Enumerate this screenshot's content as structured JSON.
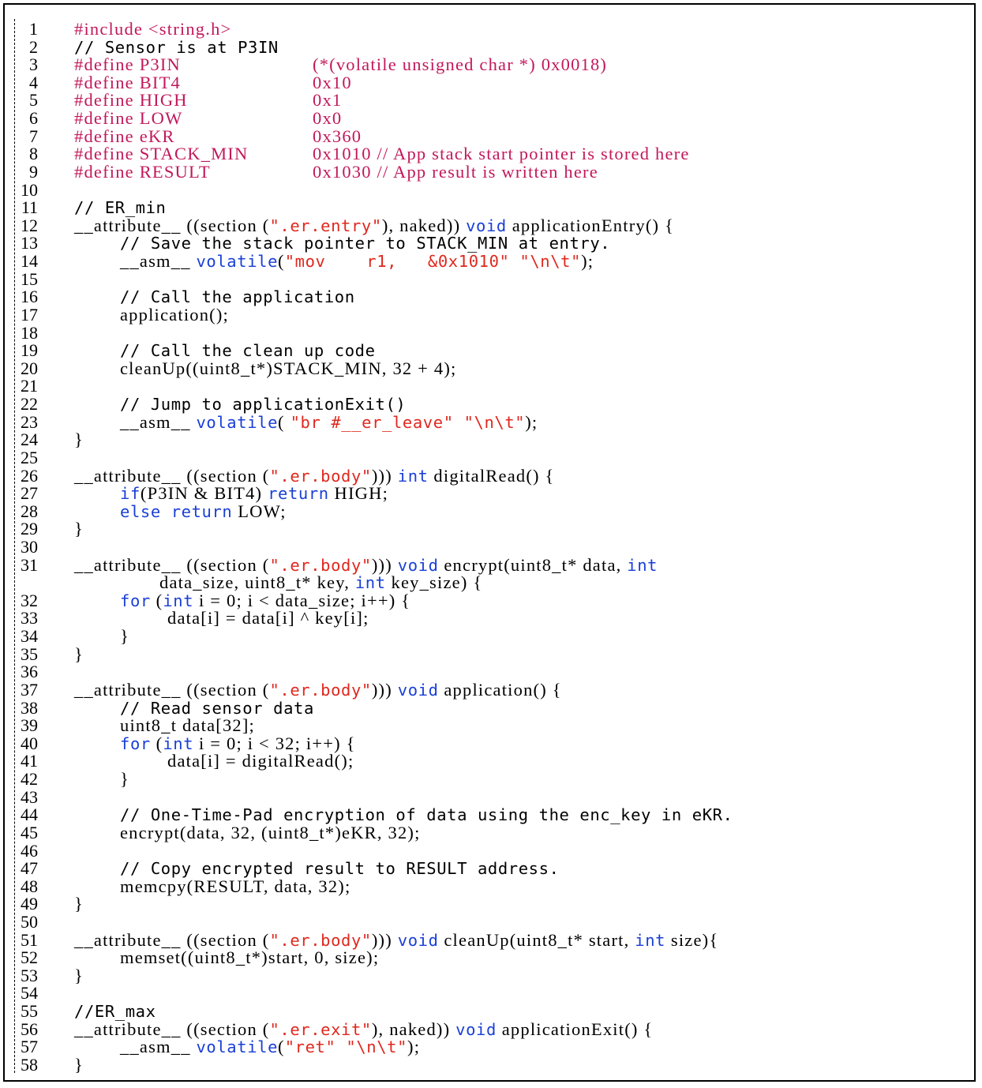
{
  "colors": {
    "preprocessor": "#c2185b",
    "keyword": "#1a3fd6",
    "string": "#e0281e",
    "text": "#000000"
  },
  "lines": [
    {
      "n": "1",
      "indent": 0,
      "tokens": [
        {
          "t": "pp",
          "v": "#include <string.h>"
        }
      ]
    },
    {
      "n": "2",
      "indent": 0,
      "tokens": [
        {
          "t": "cm",
          "v": "// Sensor is at P3IN"
        }
      ]
    },
    {
      "n": "3",
      "indent": 0,
      "tokens": [
        {
          "t": "pp",
          "v": "#define P3IN"
        },
        {
          "t": "pp",
          "v": "(*(volatile unsigned char *) 0x0018)",
          "col": 2
        }
      ]
    },
    {
      "n": "4",
      "indent": 0,
      "tokens": [
        {
          "t": "pp",
          "v": "#define BIT4"
        },
        {
          "t": "pp",
          "v": "0x10",
          "col": 2
        }
      ]
    },
    {
      "n": "5",
      "indent": 0,
      "tokens": [
        {
          "t": "pp",
          "v": "#define HIGH"
        },
        {
          "t": "pp",
          "v": "0x1",
          "col": 2
        }
      ]
    },
    {
      "n": "6",
      "indent": 0,
      "tokens": [
        {
          "t": "pp",
          "v": "#define LOW"
        },
        {
          "t": "pp",
          "v": "0x0",
          "col": 2
        }
      ]
    },
    {
      "n": "7",
      "indent": 0,
      "tokens": [
        {
          "t": "pp",
          "v": "#define eKR"
        },
        {
          "t": "pp",
          "v": "0x360",
          "col": 2
        }
      ]
    },
    {
      "n": "8",
      "indent": 0,
      "tokens": [
        {
          "t": "pp",
          "v": "#define STACK_MIN"
        },
        {
          "t": "pp",
          "v": "0x1010 // App stack start pointer is stored here",
          "col": 2
        }
      ]
    },
    {
      "n": "9",
      "indent": 0,
      "tokens": [
        {
          "t": "pp",
          "v": "#define RESULT"
        },
        {
          "t": "pp",
          "v": "0x1030 // App result is written here",
          "col": 2
        }
      ]
    },
    {
      "n": "10",
      "indent": 0,
      "tokens": []
    },
    {
      "n": "11",
      "indent": 0,
      "tokens": [
        {
          "t": "cm",
          "v": "// ER_min"
        }
      ]
    },
    {
      "n": "12",
      "indent": 0,
      "tokens": [
        {
          "t": "nm",
          "v": "__attribute__ ((section ("
        },
        {
          "t": "st",
          "v": "\".er.entry\""
        },
        {
          "t": "nm",
          "v": "), naked)) "
        },
        {
          "t": "kw",
          "v": "void"
        },
        {
          "t": "nm",
          "v": " applicationEntry() {"
        }
      ]
    },
    {
      "n": "13",
      "indent": 1,
      "tokens": [
        {
          "t": "cm",
          "v": "// Save the stack pointer to STACK_MIN at entry."
        }
      ]
    },
    {
      "n": "14",
      "indent": 1,
      "tokens": [
        {
          "t": "nm",
          "v": "__asm__ "
        },
        {
          "t": "kw",
          "v": "volatile"
        },
        {
          "t": "nm",
          "v": "("
        },
        {
          "t": "st",
          "v": "\"mov    r1,   &0x1010\" \"\\n\\t\""
        },
        {
          "t": "nm",
          "v": ");"
        }
      ]
    },
    {
      "n": "15",
      "indent": 0,
      "tokens": []
    },
    {
      "n": "16",
      "indent": 1,
      "tokens": [
        {
          "t": "cm",
          "v": "// Call the application"
        }
      ]
    },
    {
      "n": "17",
      "indent": 1,
      "tokens": [
        {
          "t": "nm",
          "v": "application();"
        }
      ]
    },
    {
      "n": "18",
      "indent": 0,
      "tokens": []
    },
    {
      "n": "19",
      "indent": 1,
      "tokens": [
        {
          "t": "cm",
          "v": "// Call the clean up code"
        }
      ]
    },
    {
      "n": "20",
      "indent": 1,
      "tokens": [
        {
          "t": "nm",
          "v": "cleanUp((uint8_t*)STACK_MIN, 32 + 4);"
        }
      ]
    },
    {
      "n": "21",
      "indent": 0,
      "tokens": []
    },
    {
      "n": "22",
      "indent": 1,
      "tokens": [
        {
          "t": "cm",
          "v": "// Jump to applicationExit()"
        }
      ]
    },
    {
      "n": "23",
      "indent": 1,
      "tokens": [
        {
          "t": "nm",
          "v": "__asm__ "
        },
        {
          "t": "kw",
          "v": "volatile"
        },
        {
          "t": "nm",
          "v": "( "
        },
        {
          "t": "st",
          "v": "\"br #__er_leave\" \"\\n\\t\""
        },
        {
          "t": "nm",
          "v": ");"
        }
      ]
    },
    {
      "n": "24",
      "indent": 0,
      "tokens": [
        {
          "t": "nm",
          "v": "}"
        }
      ]
    },
    {
      "n": "25",
      "indent": 0,
      "tokens": []
    },
    {
      "n": "26",
      "indent": 0,
      "tokens": [
        {
          "t": "nm",
          "v": "__attribute__ ((section ("
        },
        {
          "t": "st",
          "v": "\".er.body\""
        },
        {
          "t": "nm",
          "v": "))) "
        },
        {
          "t": "kw",
          "v": "int"
        },
        {
          "t": "nm",
          "v": " digitalRead() {"
        }
      ]
    },
    {
      "n": "27",
      "indent": 1,
      "tokens": [
        {
          "t": "kw",
          "v": "if"
        },
        {
          "t": "nm",
          "v": "(P3IN & BIT4) "
        },
        {
          "t": "kw",
          "v": "return"
        },
        {
          "t": "nm",
          "v": " HIGH;"
        }
      ]
    },
    {
      "n": "28",
      "indent": 1,
      "tokens": [
        {
          "t": "kw",
          "v": "else return"
        },
        {
          "t": "nm",
          "v": " LOW;"
        }
      ]
    },
    {
      "n": "29",
      "indent": 0,
      "tokens": [
        {
          "t": "nm",
          "v": "}"
        }
      ]
    },
    {
      "n": "30",
      "indent": 0,
      "tokens": []
    },
    {
      "n": "31",
      "indent": 0,
      "tokens": [
        {
          "t": "nm",
          "v": "__attribute__ ((section ("
        },
        {
          "t": "st",
          "v": "\".er.body\""
        },
        {
          "t": "nm",
          "v": "))) "
        },
        {
          "t": "kw",
          "v": "void"
        },
        {
          "t": "nm",
          "v": " encrypt(uint8_t* data, "
        },
        {
          "t": "kw",
          "v": "int"
        }
      ]
    },
    {
      "n": "",
      "indent": 2,
      "tokens": [
        {
          "t": "nm",
          "v": "data_size, uint8_t* key, "
        },
        {
          "t": "kw",
          "v": "int"
        },
        {
          "t": "nm",
          "v": " key_size) {"
        }
      ]
    },
    {
      "n": "32",
      "indent": 1,
      "tokens": [
        {
          "t": "kw",
          "v": "for"
        },
        {
          "t": "nm",
          "v": " ("
        },
        {
          "t": "kw",
          "v": "int"
        },
        {
          "t": "nm",
          "v": " i = 0; i < data_size; i++) {"
        }
      ]
    },
    {
      "n": "33",
      "indent": 3,
      "tokens": [
        {
          "t": "nm",
          "v": "data[i] = data[i] ^ key[i];"
        }
      ]
    },
    {
      "n": "34",
      "indent": 1,
      "tokens": [
        {
          "t": "nm",
          "v": "}"
        }
      ]
    },
    {
      "n": "35",
      "indent": 0,
      "tokens": [
        {
          "t": "nm",
          "v": "}"
        }
      ]
    },
    {
      "n": "36",
      "indent": 0,
      "tokens": []
    },
    {
      "n": "37",
      "indent": 0,
      "tokens": [
        {
          "t": "nm",
          "v": "__attribute__ ((section ("
        },
        {
          "t": "st",
          "v": "\".er.body\""
        },
        {
          "t": "nm",
          "v": "))) "
        },
        {
          "t": "kw",
          "v": "void"
        },
        {
          "t": "nm",
          "v": " application() {"
        }
      ]
    },
    {
      "n": "38",
      "indent": 1,
      "tokens": [
        {
          "t": "cm",
          "v": "// Read sensor data"
        }
      ]
    },
    {
      "n": "39",
      "indent": 1,
      "tokens": [
        {
          "t": "nm",
          "v": "uint8_t data[32];"
        }
      ]
    },
    {
      "n": "40",
      "indent": 1,
      "tokens": [
        {
          "t": "kw",
          "v": "for"
        },
        {
          "t": "nm",
          "v": " ("
        },
        {
          "t": "kw",
          "v": "int"
        },
        {
          "t": "nm",
          "v": " i = 0; i < 32; i++) {"
        }
      ]
    },
    {
      "n": "41",
      "indent": 3,
      "tokens": [
        {
          "t": "nm",
          "v": "data[i] = digitalRead();"
        }
      ]
    },
    {
      "n": "42",
      "indent": 1,
      "tokens": [
        {
          "t": "nm",
          "v": "}"
        }
      ]
    },
    {
      "n": "43",
      "indent": 0,
      "tokens": []
    },
    {
      "n": "44",
      "indent": 1,
      "tokens": [
        {
          "t": "cm",
          "v": "// One-Time-Pad encryption of data using the enc_key in eKR."
        }
      ]
    },
    {
      "n": "45",
      "indent": 1,
      "tokens": [
        {
          "t": "nm",
          "v": "encrypt(data, 32, (uint8_t*)eKR, 32);"
        }
      ]
    },
    {
      "n": "46",
      "indent": 0,
      "tokens": []
    },
    {
      "n": "47",
      "indent": 1,
      "tokens": [
        {
          "t": "cm",
          "v": "// Copy encrypted result to RESULT address."
        }
      ]
    },
    {
      "n": "48",
      "indent": 1,
      "tokens": [
        {
          "t": "nm",
          "v": "memcpy(RESULT, data, 32);"
        }
      ]
    },
    {
      "n": "49",
      "indent": 0,
      "tokens": [
        {
          "t": "nm",
          "v": "}"
        }
      ]
    },
    {
      "n": "50",
      "indent": 0,
      "tokens": []
    },
    {
      "n": "51",
      "indent": 0,
      "tokens": [
        {
          "t": "nm",
          "v": "__attribute__ ((section ("
        },
        {
          "t": "st",
          "v": "\".er.body\""
        },
        {
          "t": "nm",
          "v": "))) "
        },
        {
          "t": "kw",
          "v": "void"
        },
        {
          "t": "nm",
          "v": " cleanUp(uint8_t* start, "
        },
        {
          "t": "kw",
          "v": "int"
        },
        {
          "t": "nm",
          "v": " size){"
        }
      ]
    },
    {
      "n": "52",
      "indent": 1,
      "tokens": [
        {
          "t": "nm",
          "v": "memset((uint8_t*)start, 0, size);"
        }
      ]
    },
    {
      "n": "53",
      "indent": 0,
      "tokens": [
        {
          "t": "nm",
          "v": "}"
        }
      ]
    },
    {
      "n": "54",
      "indent": 0,
      "tokens": []
    },
    {
      "n": "55",
      "indent": 0,
      "tokens": [
        {
          "t": "cm",
          "v": "//ER_max"
        }
      ]
    },
    {
      "n": "56",
      "indent": 0,
      "tokens": [
        {
          "t": "nm",
          "v": "__attribute__ ((section ("
        },
        {
          "t": "st",
          "v": "\".er.exit\""
        },
        {
          "t": "nm",
          "v": "), naked)) "
        },
        {
          "t": "kw",
          "v": "void"
        },
        {
          "t": "nm",
          "v": " applicationExit() {"
        }
      ]
    },
    {
      "n": "57",
      "indent": 1,
      "tokens": [
        {
          "t": "nm",
          "v": "__asm__ "
        },
        {
          "t": "kw",
          "v": "volatile"
        },
        {
          "t": "nm",
          "v": "("
        },
        {
          "t": "st",
          "v": "\"ret\" \"\\n\\t\""
        },
        {
          "t": "nm",
          "v": ");"
        }
      ]
    },
    {
      "n": "58",
      "indent": 0,
      "tokens": [
        {
          "t": "nm",
          "v": "}"
        }
      ]
    }
  ]
}
